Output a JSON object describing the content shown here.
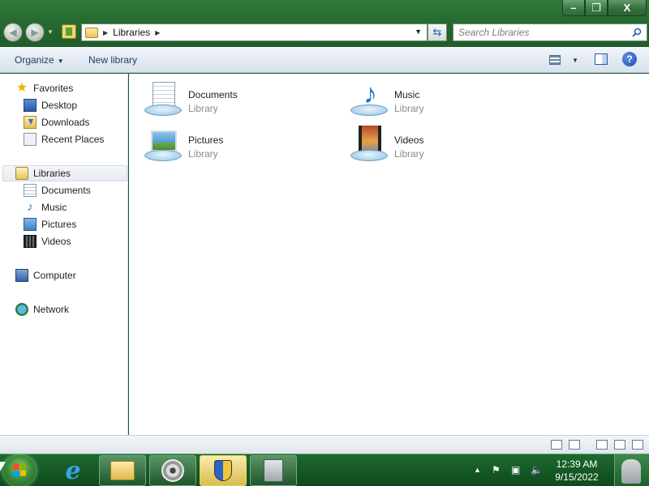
{
  "window": {
    "controls": {
      "minimize": "–",
      "maximize": "❐",
      "close": "X"
    }
  },
  "address": {
    "segments": [
      "Libraries"
    ],
    "search_placeholder": "Search Libraries"
  },
  "commandbar": {
    "organize": "Organize",
    "new_library": "New library"
  },
  "nav": {
    "favorites": "Favorites",
    "desktop": "Desktop",
    "downloads": "Downloads",
    "recent_places": "Recent Places",
    "libraries": "Libraries",
    "documents": "Documents",
    "music": "Music",
    "pictures": "Pictures",
    "videos": "Videos",
    "computer": "Computer",
    "network": "Network"
  },
  "libraries": [
    {
      "name": "Documents",
      "kind": "Library",
      "icon": "documents-library-icon"
    },
    {
      "name": "Music",
      "kind": "Library",
      "icon": "music-library-icon"
    },
    {
      "name": "Pictures",
      "kind": "Library",
      "icon": "pictures-library-icon"
    },
    {
      "name": "Videos",
      "kind": "Library",
      "icon": "videos-library-icon"
    }
  ],
  "taskbar": {
    "items": [
      "internet-explorer-icon",
      "windows-explorer-icon",
      "media-disc-icon",
      "security-shield-icon",
      "installer-icon"
    ],
    "clock_time": "12:39 AM",
    "clock_date": "9/15/2022"
  },
  "colors": {
    "accent_green": "#276c31",
    "library_text": "#8a8a8a"
  }
}
